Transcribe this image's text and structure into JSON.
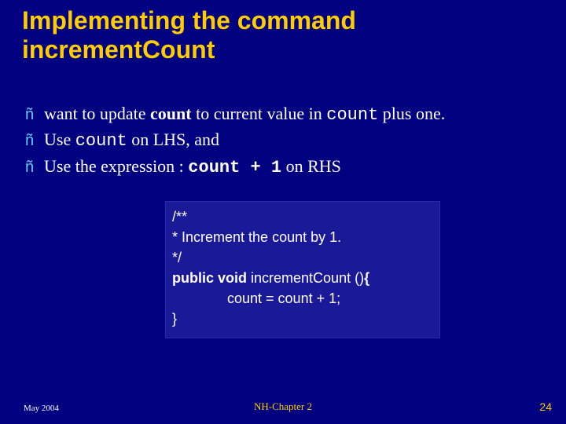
{
  "title_line1": "Implementing the command",
  "title_line2": "incrementCount",
  "bullets": {
    "marker": "ñ",
    "b1_pre": "want to update ",
    "b1_count1": "count",
    "b1_mid": " to current value in ",
    "b1_count2": "count",
    "b1_post": " plus one.",
    "b2_pre": "Use ",
    "b2_count": "count",
    "b2_post": " on LHS, and",
    "b3_pre": "Use the expression :  ",
    "b3_expr": "count + 1",
    "b3_post": "  on RHS"
  },
  "code": {
    "l1": "/**",
    "l2": " * Increment the count by 1.",
    "l3": " */",
    "l4a": "public void",
    "l4b": " incrementCount ()",
    "l4c": "{",
    "l5": "count = count + 1;",
    "l6": "}"
  },
  "footer": {
    "left": "May 2004",
    "center": "NH-Chapter 2",
    "right": "24"
  }
}
